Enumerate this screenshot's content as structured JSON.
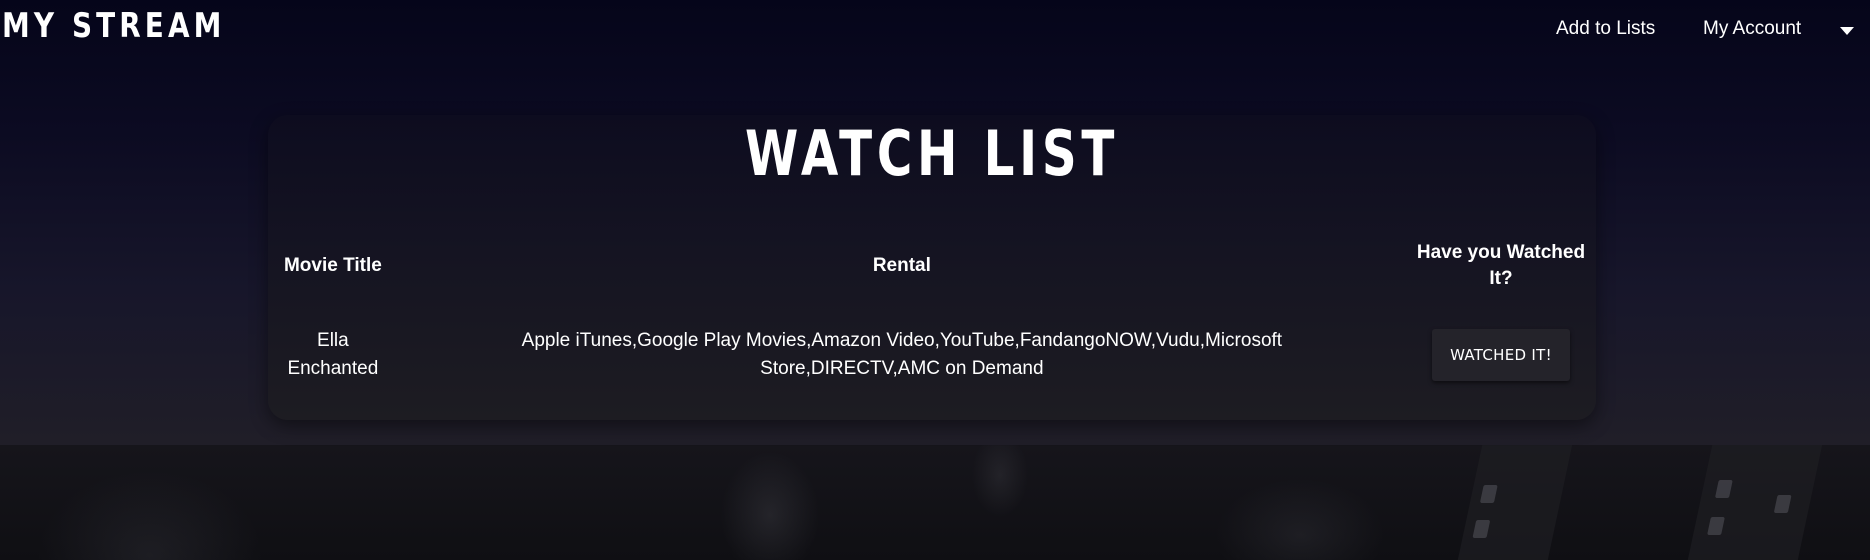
{
  "navbar": {
    "brand": "MY STREAM",
    "links": {
      "add_to_lists": "Add to Lists",
      "my_account": "My Account"
    }
  },
  "watch_list": {
    "title": "WATCH LIST",
    "columns": {
      "movie_title": "Movie Title",
      "rental": "Rental",
      "watched": "Have you Watched It?"
    },
    "rows": [
      {
        "movie_title": "Ella Enchanted",
        "rental": "Apple iTunes,Google Play Movies,Amazon Video,YouTube,FandangoNOW,Vudu,Microsoft Store,DIRECTV,AMC on Demand",
        "action_label": "WATCHED IT!"
      }
    ]
  },
  "icons": {
    "account_dropdown": "caret-down-icon"
  }
}
